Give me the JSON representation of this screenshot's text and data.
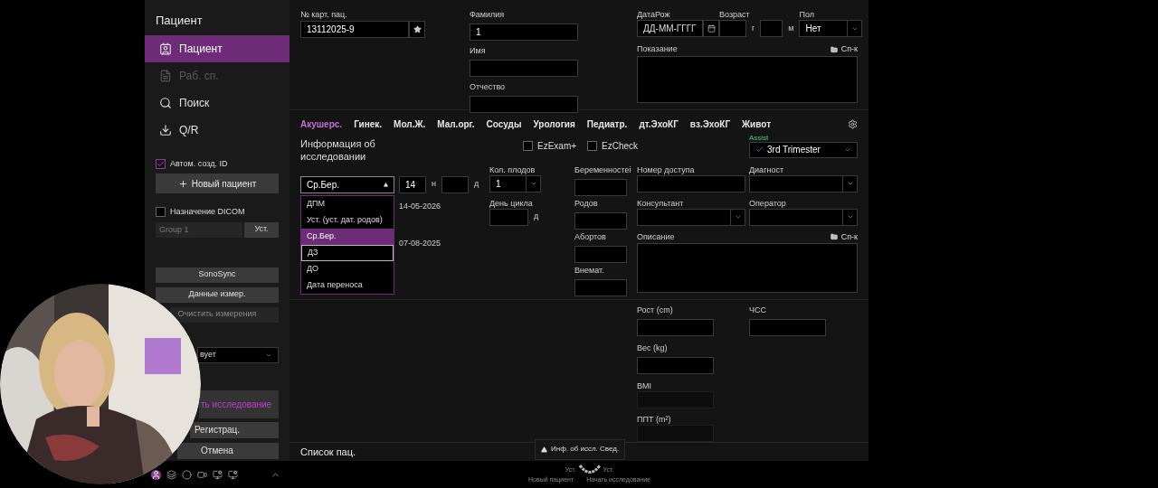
{
  "sidebar": {
    "title": "Пациент",
    "nav": [
      {
        "kind": "person",
        "label": "Пациент",
        "selected": true,
        "disabled": false
      },
      {
        "kind": "file",
        "label": "Раб. сп.",
        "selected": false,
        "disabled": true
      },
      {
        "kind": "search",
        "label": "Поиск",
        "selected": false,
        "disabled": false
      },
      {
        "kind": "download",
        "label": "Q/R",
        "selected": false,
        "disabled": false
      }
    ],
    "auto_id": {
      "label": "Автом. созд. ID",
      "checked": true
    },
    "new_patient": "Новый пациент",
    "dicom": {
      "label": "Назначение DICOM",
      "checked": false,
      "group_placeholder": "Group 1",
      "set_button": "Уст."
    },
    "buttons": [
      {
        "label": "SonoSync",
        "disabled": false
      },
      {
        "label": "Данные измер.",
        "disabled": false
      },
      {
        "label": "Очистить измерения",
        "disabled": true
      }
    ],
    "select_value": "вует",
    "start_exam": "ть исследование",
    "actions": [
      "Регистрац.",
      "Отмена"
    ]
  },
  "patient": {
    "card_label": "№ карт. пац.",
    "card_value": "13112025-9",
    "last_name_label": "Фамилия",
    "last_name": "1",
    "first_name_label": "Имя",
    "middle_name_label": "Отчество",
    "dob_label": "ДатаРож",
    "dob_placeholder": "ДД-ММ-ГГГГ",
    "age_label": "Возраст",
    "years_unit": "г",
    "months_unit": "м",
    "sex_label": "Пол",
    "sex": "Нет",
    "indication_label": "Показание",
    "list_link": "Сп-к"
  },
  "tabs": [
    {
      "label": "Акушерс.",
      "selected": true
    },
    {
      "label": "Гинек.",
      "selected": false
    },
    {
      "label": "Мол.Ж.",
      "selected": false
    },
    {
      "label": "Мал.орг.",
      "selected": false
    },
    {
      "label": "Сосуды",
      "selected": false
    },
    {
      "label": "Урология",
      "selected": false
    },
    {
      "label": "Педиатр.",
      "selected": false
    },
    {
      "label": "дт.ЭхоКГ",
      "selected": false
    },
    {
      "label": "вз.ЭхоКГ",
      "selected": false
    },
    {
      "label": "Живот",
      "selected": false
    }
  ],
  "exam": {
    "heading": "Информация об исследовании",
    "checks": [
      {
        "label": "EzExam+",
        "checked": false
      },
      {
        "label": "EzCheck",
        "checked": false
      }
    ],
    "assist_label": "Assist",
    "assist_value": "3rd Trimester",
    "method": {
      "value": "Ср.Бер.",
      "weeks": "14",
      "weeks_unit": "н",
      "days_unit": "д",
      "options": [
        {
          "label": "ДПМ",
          "selected": false,
          "hovered": false
        },
        {
          "label": "Уст. (уст. дат. родов)",
          "selected": false,
          "hovered": false
        },
        {
          "label": "Ср.Бер.",
          "selected": true,
          "hovered": false
        },
        {
          "label": "ДЗ",
          "selected": false,
          "hovered": true
        },
        {
          "label": "ДО",
          "selected": false,
          "hovered": false
        },
        {
          "label": "Дата переноса",
          "selected": false,
          "hovered": false
        }
      ],
      "dates": [
        "14-05-2026",
        "07-08-2025"
      ]
    },
    "fetus_label": "Кол. плодов",
    "fetus_value": "1",
    "cycle_label": "День цикла",
    "cycle_unit": "д",
    "counts": [
      "Беременностеі",
      "Родов",
      "Абортов",
      "Внемат."
    ],
    "access_label": "Номер доступа",
    "consultant_label": "Консультант",
    "description_label": "Описание",
    "description_link": "Сп-к",
    "diagnostician_label": "Диагност",
    "operator_label": "Оператор"
  },
  "measures": {
    "height_label": "Рост (cm)",
    "hr_label": "ЧСС",
    "weight_label": "Вес (kg)",
    "bmi_label": "BMI",
    "bsa_label": "ППТ (m²)"
  },
  "footer": {
    "patient_list": "Список пац.",
    "info_tab": "Инф. об иссл. Свед."
  },
  "taskbar": {
    "left_label": "Уст.",
    "right_label": "Уст.",
    "left_caption": "Новый пациент",
    "right_caption": "Начать исследование"
  }
}
